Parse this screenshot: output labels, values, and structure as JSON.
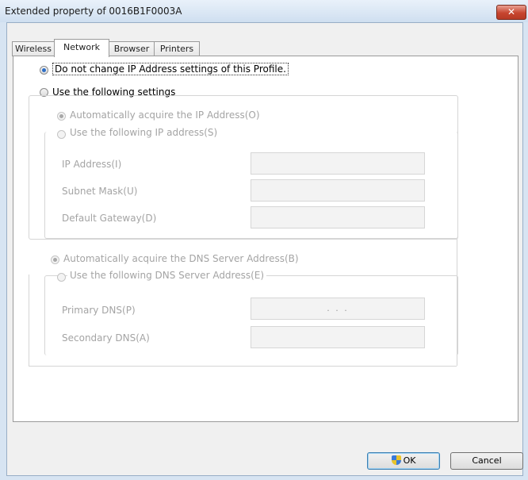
{
  "window": {
    "title": "Extended property of 0016B1F0003A",
    "close_glyph": "✕"
  },
  "tabs": [
    {
      "label": "Wireless"
    },
    {
      "label": "Network"
    },
    {
      "label": "Browser"
    },
    {
      "label": "Printers"
    }
  ],
  "ip_options": {
    "no_change": "Do not change IP Address settings of this Profile.",
    "use_following": "Use the following settings"
  },
  "ip_settings": {
    "auto_acquire": "Automatically acquire the IP Address(O)",
    "use_following_ip": "Use the following IP address(S)",
    "ip_address_label": "IP Address(I)",
    "subnet_mask_label": "Subnet Mask(U)",
    "default_gateway_label": "Default Gateway(D)"
  },
  "dns_settings": {
    "auto_acquire": "Automatically acquire the DNS Server Address(B)",
    "use_following": "Use the following DNS Server Address(E)",
    "primary_label": "Primary DNS(P)",
    "primary_value": ". . .",
    "secondary_label": "Secondary DNS(A)"
  },
  "buttons": {
    "ok": "OK",
    "cancel": "Cancel"
  },
  "icons": {
    "ok_icon": "shield-icon"
  }
}
